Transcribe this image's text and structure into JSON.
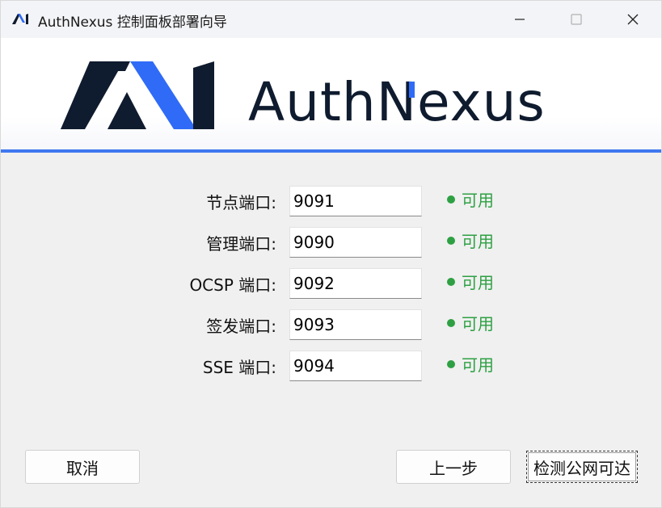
{
  "window": {
    "title": "AuthNexus 控制面板部署向导",
    "minimize_icon": "minimize-icon",
    "maximize_icon": "maximize-icon",
    "close_icon": "close-icon"
  },
  "banner": {
    "brand_name": "AuthNexus",
    "brand_color": "#0f1b2e",
    "accent_color": "#2f6bf6",
    "divider_color": "#3f78f0"
  },
  "ports": [
    {
      "label": "节点端口:",
      "value": "9091",
      "status": "可用"
    },
    {
      "label": "管理端口:",
      "value": "9090",
      "status": "可用"
    },
    {
      "label": "OCSP 端口:",
      "value": "9092",
      "status": "可用"
    },
    {
      "label": "签发端口:",
      "value": "9093",
      "status": "可用"
    },
    {
      "label": "SSE 端口:",
      "value": "9094",
      "status": "可用"
    }
  ],
  "status_color": "#2ea043",
  "buttons": {
    "cancel": "取消",
    "back": "上一步",
    "check": "检测公网可达"
  }
}
